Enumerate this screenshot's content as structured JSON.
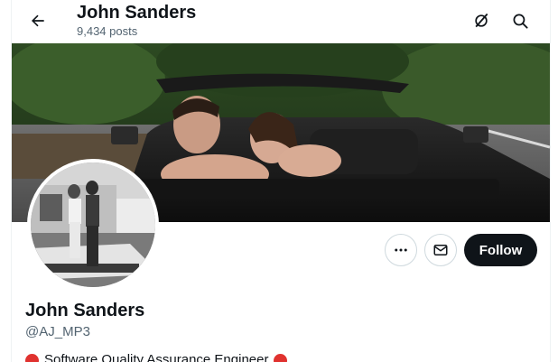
{
  "header": {
    "title": "John Sanders",
    "post_count": "9,434 posts",
    "back_icon": "arrow-left-icon",
    "grok_icon": "grok-icon",
    "search_icon": "search-icon"
  },
  "banner": {
    "description_icon": "cover-photo"
  },
  "avatar": {
    "icon": "profile-photo"
  },
  "actions": {
    "more_icon": "more-horizontal-icon",
    "message_icon": "envelope-icon",
    "follow_label": "Follow"
  },
  "profile": {
    "name": "John Sanders",
    "handle": "@AJ_MP3",
    "bio": "Software Quality Assurance Engineer"
  },
  "colors": {
    "text": "#0f1419",
    "secondary": "#536471",
    "border": "#cfd9de",
    "follow_bg": "#0f1419",
    "emoji_red": "#e0322f"
  }
}
